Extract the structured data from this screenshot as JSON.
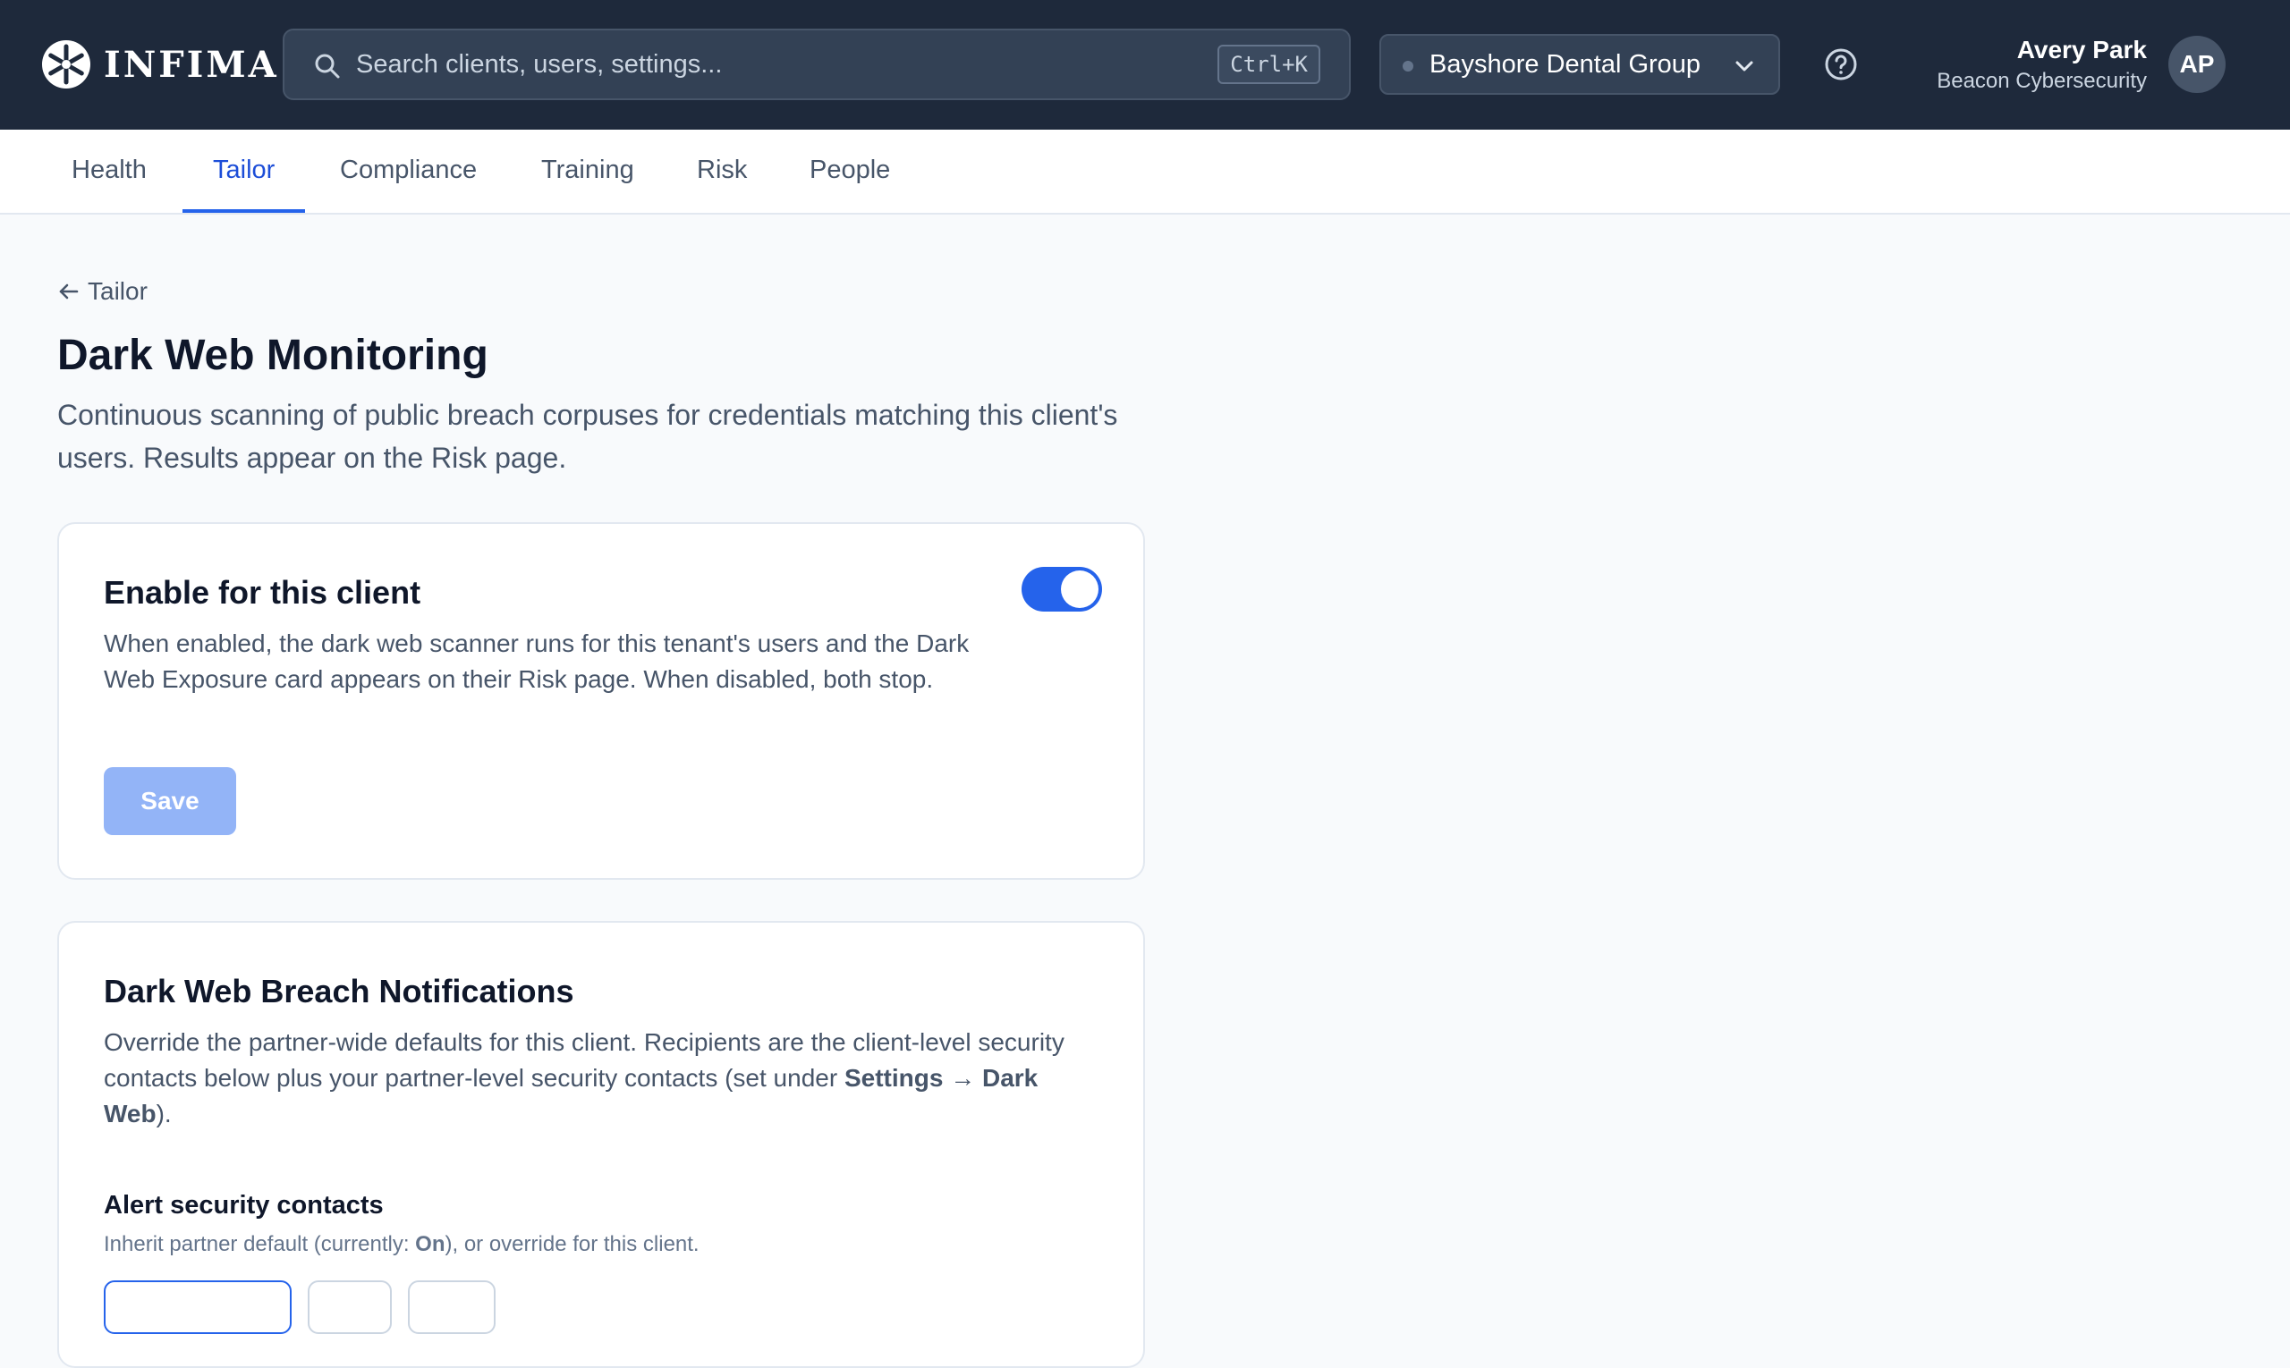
{
  "header": {
    "logo_text": "INFIMA",
    "search": {
      "placeholder": "Search clients, users, settings...",
      "shortcut": "Ctrl+K"
    },
    "client_selector": {
      "value": "Bayshore Dental Group"
    },
    "user": {
      "name": "Avery Park",
      "org": "Beacon Cybersecurity",
      "initials": "AP"
    }
  },
  "tabs": [
    {
      "label": "Health",
      "active": false
    },
    {
      "label": "Tailor",
      "active": true
    },
    {
      "label": "Compliance",
      "active": false
    },
    {
      "label": "Training",
      "active": false
    },
    {
      "label": "Risk",
      "active": false
    },
    {
      "label": "People",
      "active": false
    }
  ],
  "page": {
    "back_label": "Tailor",
    "title": "Dark Web Monitoring",
    "description": "Continuous scanning of public breach corpuses for credentials matching this client's users. Results appear on the Risk page."
  },
  "enable_card": {
    "title": "Enable for this client",
    "description": "When enabled, the dark web scanner runs for this tenant's users and the Dark Web Exposure card appears on their Risk page. When disabled, both stop.",
    "toggle_on": true,
    "save_label": "Save"
  },
  "notifications_card": {
    "title": "Dark Web Breach Notifications",
    "description_pre": "Override the partner-wide defaults for this client. Recipients are the client-level security contacts below plus your partner-level security contacts (set under ",
    "description_bold": "Settings → Dark Web",
    "description_post": ").",
    "alert_title": "Alert security contacts",
    "alert_desc_pre": "Inherit partner default (currently: ",
    "alert_desc_bold": "On",
    "alert_desc_post": "), or override for this client."
  },
  "colors": {
    "topbar_bg": "#1e293b",
    "accent": "#2563eb",
    "save_disabled": "#93b4f7"
  }
}
